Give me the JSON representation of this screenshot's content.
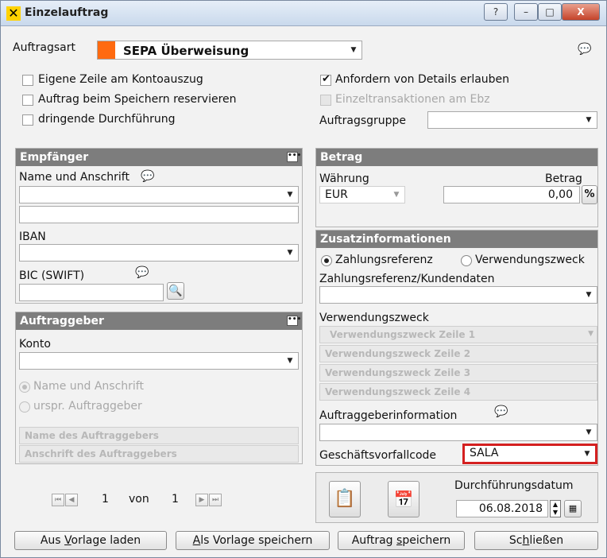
{
  "window": {
    "title": "Einzelauftrag",
    "help_btn": "?",
    "min_btn": "–",
    "max_btn": "□",
    "close_btn": "X"
  },
  "top": {
    "auftragsart_label": "Auftragsart",
    "auftragsart_value": "SEPA Überweisung",
    "auftragsart_color": "#ff6a10",
    "cb_eigene_zeile": {
      "label": "Eigene Zeile am Kontoauszug",
      "checked": false
    },
    "cb_reservieren": {
      "label": "Auftrag beim Speichern reservieren",
      "checked": false
    },
    "cb_dringend": {
      "label": "dringende Durchführung",
      "checked": false
    },
    "cb_details": {
      "label": "Anfordern von Details erlauben",
      "checked": true
    },
    "cb_einzeltrans": {
      "label": "Einzeltransaktionen am Ebz",
      "checked": false,
      "disabled": true
    },
    "auftragsgruppe_label": "Auftragsgruppe",
    "auftragsgruppe_value": ""
  },
  "empfaenger": {
    "header": "Empfänger",
    "name_label": "Name und Anschrift",
    "iban_label": "IBAN",
    "bic_label": "BIC (SWIFT)"
  },
  "auftraggeber": {
    "header": "Auftraggeber",
    "konto_label": "Konto",
    "radio_name": "Name und Anschrift",
    "radio_urspr": "urspr. Auftraggeber",
    "name_placeholder": "Name des Auftraggebers",
    "anschrift_placeholder": "Anschrift des Auftraggebers"
  },
  "pager": {
    "current": "1",
    "of_label": "von",
    "total": "1"
  },
  "betrag": {
    "header": "Betrag",
    "waehrung_label": "Währung",
    "waehrung_value": "EUR",
    "betrag_label": "Betrag",
    "betrag_value": "0,00",
    "percent_btn": "%"
  },
  "zusatz": {
    "header": "Zusatzinformationen",
    "radio_zahlungsref": "Zahlungsreferenz",
    "radio_verwendung": "Verwendungszweck",
    "zahlungsref_label": "Zahlungsreferenz/Kundendaten",
    "verwendung_label": "Verwendungszweck",
    "vz_lines": [
      "Verwendungszweck Zeile 1",
      "Verwendungszweck Zeile 2",
      "Verwendungszweck Zeile 3",
      "Verwendungszweck Zeile 4"
    ],
    "auftraggeberinfo_label": "Auftraggeberinformation",
    "gvc_label": "Geschäftsvorfallcode",
    "gvc_value": "SALA",
    "gvc_highlight": "#d42020"
  },
  "datum": {
    "label": "Durchführungsdatum",
    "value": "06.08.2018"
  },
  "buttons": {
    "vorlage_laden_pre": "Aus ",
    "vorlage_laden_u": "V",
    "vorlage_laden_post": "orlage laden",
    "vorlage_speichern_pre": "",
    "vorlage_speichern_u": "A",
    "vorlage_speichern_post": "ls Vorlage speichern",
    "auftrag_speichern_pre": "Auftrag ",
    "auftrag_speichern_u": "s",
    "auftrag_speichern_post": "peichern",
    "schliessen_pre": "Sc",
    "schliessen_u": "h",
    "schliessen_post": "ließen"
  }
}
